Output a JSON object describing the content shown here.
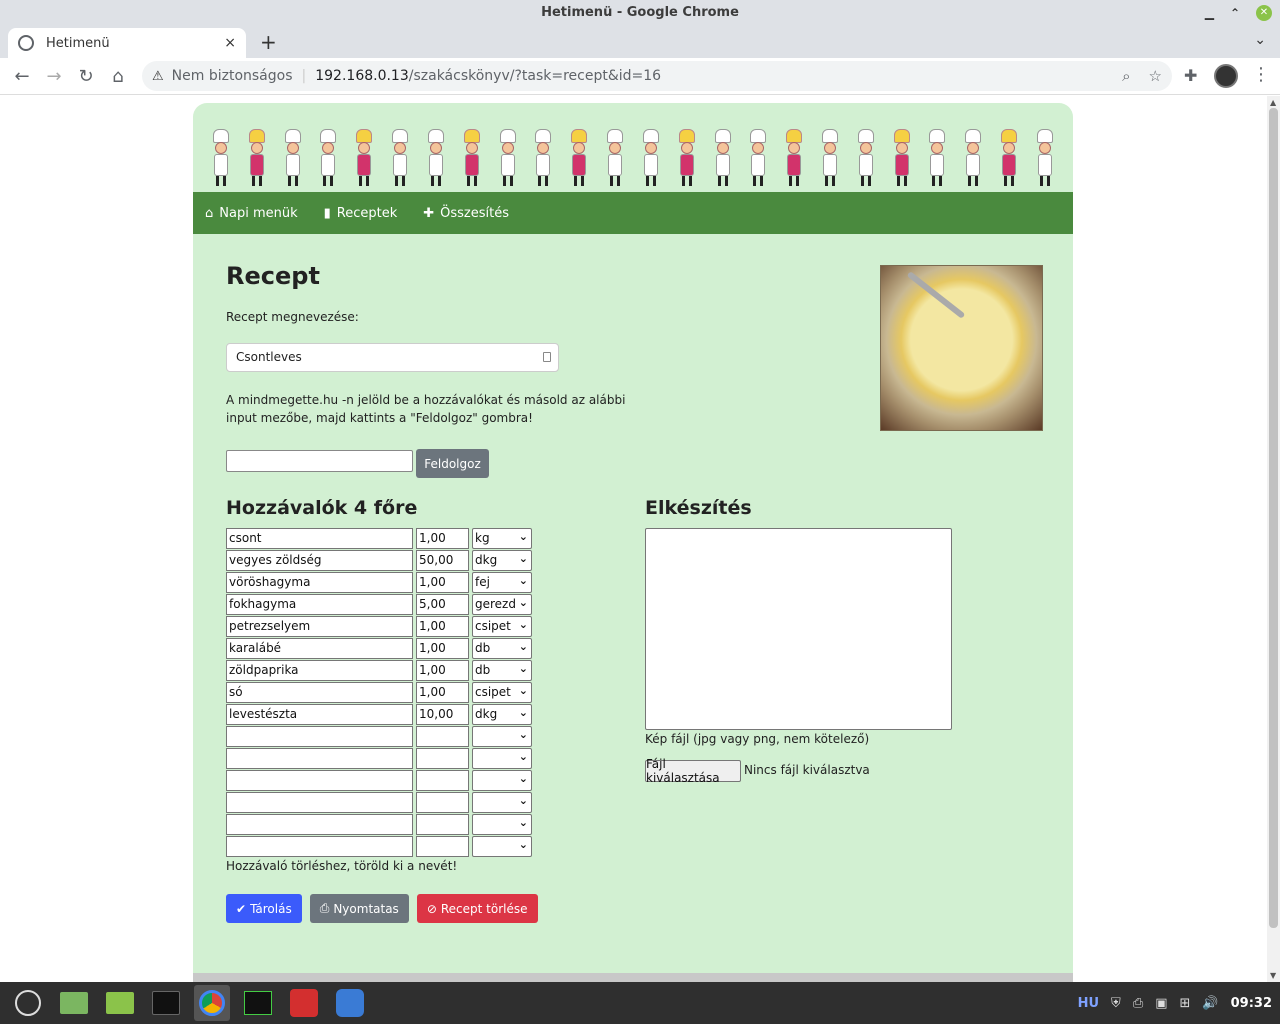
{
  "window": {
    "title": "Hetimenü - Google Chrome"
  },
  "tab": {
    "title": "Hetimenü",
    "close": "×",
    "new": "+"
  },
  "omnibox": {
    "security": "Nem biztonságos",
    "host": "192.168.0.13",
    "path": "/szakácskönyv/?task=recept&id=16"
  },
  "nav": {
    "items": [
      {
        "icon": "home-icon",
        "label": "Napi menük"
      },
      {
        "icon": "book-icon",
        "label": "Receptek"
      },
      {
        "icon": "plus-icon",
        "label": "Összesítés"
      }
    ]
  },
  "recipe": {
    "heading": "Recept",
    "name_label": "Recept megnevezése:",
    "name_value": "Csontleves",
    "instructions": "A mindmegette.hu -n jelöld be a hozzávalókat és másold az alábbi input mezőbe, majd kattints a \"Feldolgoz\" gombra!",
    "process_button": "Feldolgoz",
    "ingredients_heading": "Hozzávalók 4 főre",
    "ingredients": [
      {
        "name": "csont",
        "qty": "1,00",
        "unit": "kg"
      },
      {
        "name": "vegyes zöldség",
        "qty": "50,00",
        "unit": "dkg"
      },
      {
        "name": "vöröshagyma",
        "qty": "1,00",
        "unit": "fej"
      },
      {
        "name": "fokhagyma",
        "qty": "5,00",
        "unit": "gerezd"
      },
      {
        "name": "petrezselyem",
        "qty": "1,00",
        "unit": "csipet"
      },
      {
        "name": "karalábé",
        "qty": "1,00",
        "unit": "db"
      },
      {
        "name": "zöldpaprika",
        "qty": "1,00",
        "unit": "db"
      },
      {
        "name": "só",
        "qty": "1,00",
        "unit": "csipet"
      },
      {
        "name": "levestészta",
        "qty": "10,00",
        "unit": "dkg"
      },
      {
        "name": "",
        "qty": "",
        "unit": ""
      },
      {
        "name": "",
        "qty": "",
        "unit": ""
      },
      {
        "name": "",
        "qty": "",
        "unit": ""
      },
      {
        "name": "",
        "qty": "",
        "unit": ""
      },
      {
        "name": "",
        "qty": "",
        "unit": ""
      },
      {
        "name": "",
        "qty": "",
        "unit": ""
      }
    ],
    "delete_hint": "Hozzávaló törléshez, töröld ki a nevét!",
    "prep_heading": "Elkészítés",
    "image_label": "Kép fájl (jpg vagy png, nem kötelező)",
    "file_button": "Fájl kiválasztása",
    "file_none": "Nincs fájl kiválasztva",
    "buttons": {
      "save": "Tárolás",
      "print": "Nyomtatas",
      "delete": "Recept törlése"
    }
  },
  "taskbar": {
    "lang": "HU",
    "clock": "09:32"
  }
}
